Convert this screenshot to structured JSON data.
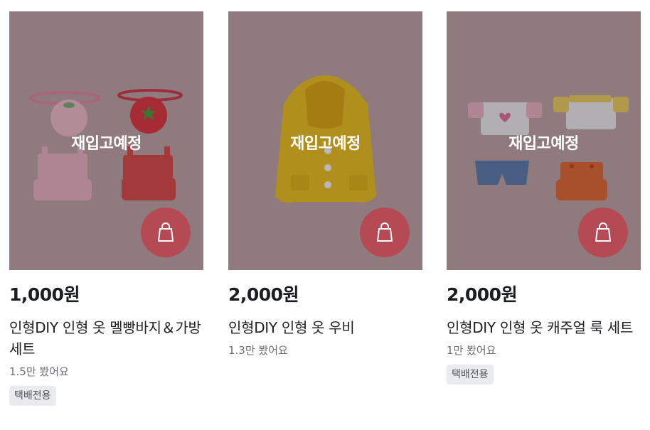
{
  "products": [
    {
      "overlay_label": "재입고예정",
      "price": "1,000원",
      "title": "인형DIY 인형 옷 멜빵바지＆가방 세트",
      "views": "1.5만 봤어요",
      "badge": "택배전용",
      "cart_icon": "shopping-bag-icon"
    },
    {
      "overlay_label": "재입고예정",
      "price": "2,000원",
      "title": "인형DIY 인형 옷 우비",
      "views": "1.3만 봤어요",
      "cart_icon": "shopping-bag-icon"
    },
    {
      "overlay_label": "재입고예정",
      "price": "2,000원",
      "title": "인형DIY 인형 옷 캐주얼 룩 세트",
      "views": "1만 봤어요",
      "badge": "택배전용",
      "cart_icon": "shopping-bag-icon"
    }
  ],
  "colors": {
    "cart_button": "#b54a54",
    "photo_background": "#b69f9f",
    "badge_background": "#eaebee"
  }
}
